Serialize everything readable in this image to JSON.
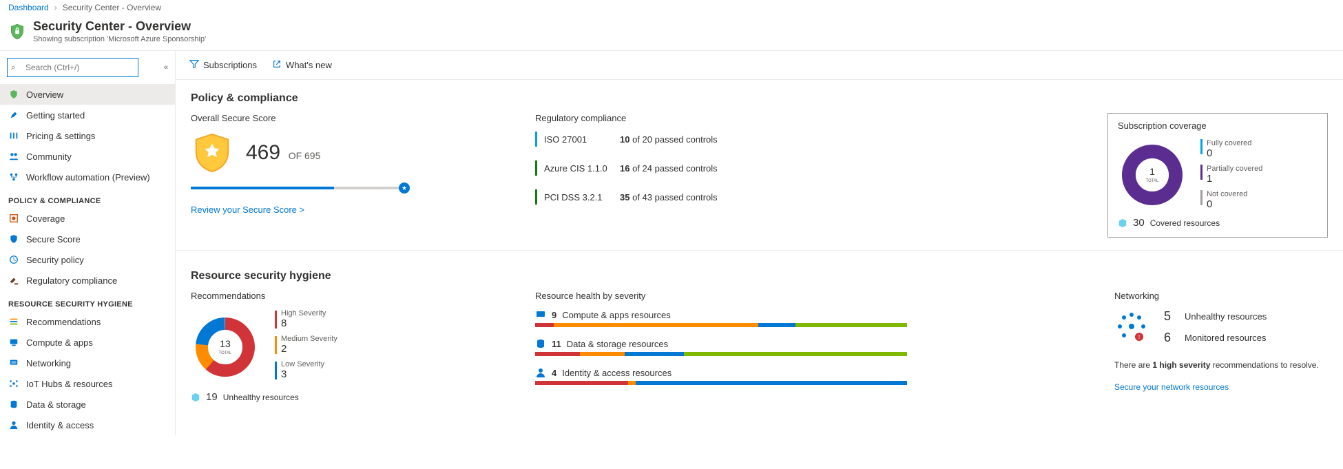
{
  "breadcrumb": {
    "root": "Dashboard",
    "current": "Security Center - Overview"
  },
  "header": {
    "title": "Security Center - Overview",
    "subtitle": "Showing subscription 'Microsoft Azure Sponsorship'"
  },
  "search": {
    "placeholder": "Search (Ctrl+/)"
  },
  "sidebar": {
    "top": [
      {
        "label": "Overview",
        "icon": "shield-icon",
        "active": true
      },
      {
        "label": "Getting started",
        "icon": "rocket-icon"
      },
      {
        "label": "Pricing & settings",
        "icon": "sliders-icon"
      },
      {
        "label": "Community",
        "icon": "people-icon"
      },
      {
        "label": "Workflow automation (Preview)",
        "icon": "flow-icon"
      }
    ],
    "sections": [
      {
        "title": "POLICY & COMPLIANCE",
        "items": [
          {
            "label": "Coverage",
            "icon": "coverage-icon"
          },
          {
            "label": "Secure Score",
            "icon": "score-icon"
          },
          {
            "label": "Security policy",
            "icon": "policy-icon"
          },
          {
            "label": "Regulatory compliance",
            "icon": "gavel-icon"
          }
        ]
      },
      {
        "title": "RESOURCE SECURITY HYGIENE",
        "items": [
          {
            "label": "Recommendations",
            "icon": "list-icon"
          },
          {
            "label": "Compute & apps",
            "icon": "compute-icon"
          },
          {
            "label": "Networking",
            "icon": "network-icon"
          },
          {
            "label": "IoT Hubs & resources",
            "icon": "iot-icon"
          },
          {
            "label": "Data & storage",
            "icon": "data-icon"
          },
          {
            "label": "Identity & access",
            "icon": "identity-icon"
          }
        ]
      }
    ]
  },
  "toolbar": {
    "subscriptions": "Subscriptions",
    "whatsnew": "What's new"
  },
  "policy": {
    "heading": "Policy & compliance",
    "score": {
      "title": "Overall Secure Score",
      "value": "469",
      "of_label": "OF 695",
      "link": "Review your Secure Score >"
    },
    "reg": {
      "title": "Regulatory compliance",
      "rows": [
        {
          "name": "ISO 27001",
          "passed": "10",
          "of_text": "of 20 passed controls",
          "color": "#00a2ed"
        },
        {
          "name": "Azure CIS 1.1.0",
          "passed": "16",
          "of_text": "of 24 passed controls",
          "color": "#107c10"
        },
        {
          "name": "PCI DSS 3.2.1",
          "passed": "35",
          "of_text": "of 43 passed controls",
          "color": "#107c10"
        }
      ]
    },
    "cov": {
      "title": "Subscription coverage",
      "center": "1",
      "center_label": "TOTAL",
      "legend": [
        {
          "label": "Fully covered",
          "value": "0",
          "color": "#00a2ed"
        },
        {
          "label": "Partially covered",
          "value": "1",
          "color": "#5c2d91"
        },
        {
          "label": "Not covered",
          "value": "0",
          "color": "#a19f9d"
        }
      ],
      "footer_count": "30",
      "footer_label": "Covered resources"
    }
  },
  "hygiene": {
    "heading": "Resource security hygiene",
    "rec": {
      "title": "Recommendations",
      "center": "13",
      "center_label": "TOTAL",
      "legend": [
        {
          "label": "High Severity",
          "value": "8",
          "color": "#d13438"
        },
        {
          "label": "Medium Severity",
          "value": "2",
          "color": "#ff8c00"
        },
        {
          "label": "Low Severity",
          "value": "3",
          "color": "#0078d4"
        }
      ],
      "footer_count": "19",
      "footer_label": "Unhealthy resources"
    },
    "health": {
      "title": "Resource health by severity",
      "rows": [
        {
          "count": "9",
          "label": "Compute & apps resources",
          "segs": [
            [
              "#d13438",
              5
            ],
            [
              "#ff8c00",
              55
            ],
            [
              "#0078d4",
              10
            ],
            [
              "#7fba00",
              30
            ]
          ]
        },
        {
          "count": "11",
          "label": "Data & storage resources",
          "segs": [
            [
              "#d13438",
              12
            ],
            [
              "#ff8c00",
              12
            ],
            [
              "#0078d4",
              16
            ],
            [
              "#7fba00",
              60
            ]
          ]
        },
        {
          "count": "4",
          "label": "Identity & access resources",
          "segs": [
            [
              "#d13438",
              25
            ],
            [
              "#ff8c00",
              2
            ],
            [
              "#0078d4",
              73
            ]
          ]
        }
      ]
    },
    "net": {
      "title": "Networking",
      "stats": [
        {
          "value": "5",
          "label": "Unhealthy resources"
        },
        {
          "value": "6",
          "label": "Monitored resources"
        }
      ],
      "note_a": "There are ",
      "note_b": "1 high severity",
      "note_c": " recommendations to resolve.",
      "link": "Secure your network resources"
    }
  },
  "chart_data": [
    {
      "type": "pie",
      "title": "Subscription coverage",
      "categories": [
        "Fully covered",
        "Partially covered",
        "Not covered"
      ],
      "values": [
        0,
        1,
        0
      ],
      "series": [
        {
          "name": "Subscriptions",
          "values": [
            0,
            1,
            0
          ]
        }
      ],
      "center_label": "1 TOTAL"
    },
    {
      "type": "pie",
      "title": "Recommendations",
      "categories": [
        "High Severity",
        "Medium Severity",
        "Low Severity"
      ],
      "values": [
        8,
        2,
        3
      ],
      "series": [
        {
          "name": "Recommendations",
          "values": [
            8,
            2,
            3
          ]
        }
      ],
      "center_label": "13 TOTAL"
    },
    {
      "type": "bar",
      "title": "Overall Secure Score",
      "categories": [
        "Secure Score"
      ],
      "values": [
        469
      ],
      "ylim": [
        0,
        695
      ]
    }
  ]
}
